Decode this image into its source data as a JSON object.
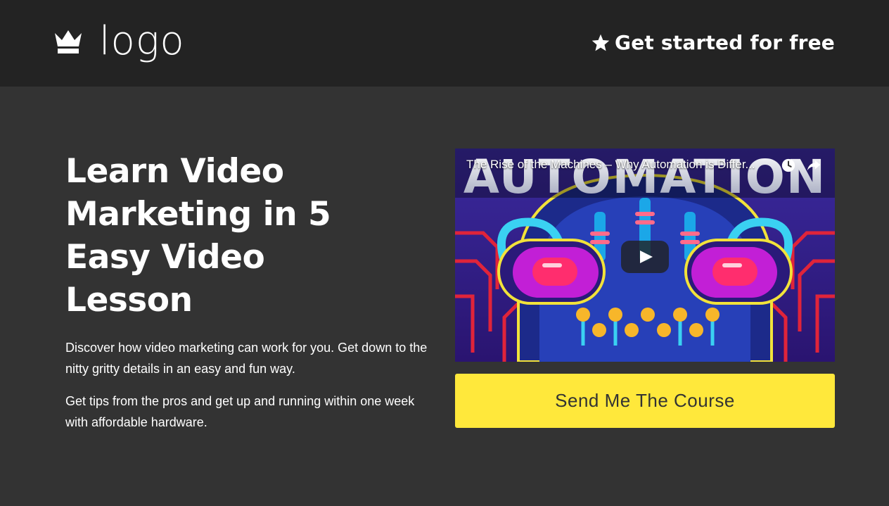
{
  "header": {
    "logo_text": "logo",
    "logo_icon": "crown-icon",
    "cta_icon": "star-icon",
    "cta_label": "Get started for free",
    "background": "#232323"
  },
  "hero": {
    "title": "Learn Video Marketing in 5 Easy Video Lesson",
    "paragraph_1": "Discover how video marketing can work for you. Get down to the nitty gritty details in an easy and fun way.",
    "paragraph_2": "Get tips from the pros and get up and running within one week with affordable hardware."
  },
  "video": {
    "title": "The Rise of the Machines – Why Automation is Differ...",
    "thumbnail_text": "AUTOMATION",
    "watch_later_icon": "clock-icon",
    "share_icon": "share-arrow-icon",
    "play_icon": "play-icon"
  },
  "cta_button": {
    "label": "Send Me The Course",
    "color": "#ffe83b"
  },
  "colors": {
    "page_background": "#333333",
    "text": "#ffffff"
  }
}
